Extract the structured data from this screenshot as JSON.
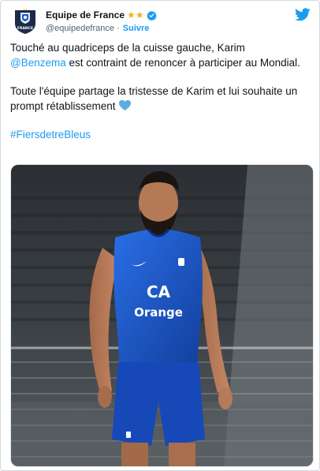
{
  "tweet": {
    "author": {
      "display_name": "Equipe de France",
      "stars": "★★",
      "handle": "@equipedefrance",
      "separator": " · ",
      "follow_label": "Suivre",
      "avatar_text": "FRANCE"
    },
    "body": {
      "line1_prefix": "Touché au quadriceps de la cuisse gauche, Karim",
      "mention": "@Benzema",
      "line1_suffix": " est contraint de renoncer à participer au Mondial.",
      "line2": "Toute l'équipe partage la tristesse de Karim et lui souhaite un prompt rétablissement",
      "hashtag": "#FiersdetreBleus"
    },
    "image": {
      "sponsor_logo": "CA",
      "sponsor_name": "Orange"
    },
    "colors": {
      "accent": "#1d9bf0",
      "star": "#f2b01e",
      "jersey": "#1b5fd6",
      "text": "#0f1419",
      "muted": "#536471"
    },
    "icons": {
      "avatar": "fff-crest-icon",
      "verified": "verified-badge-icon",
      "brand": "twitter-bird-icon",
      "heart": "blue-heart-icon"
    }
  }
}
